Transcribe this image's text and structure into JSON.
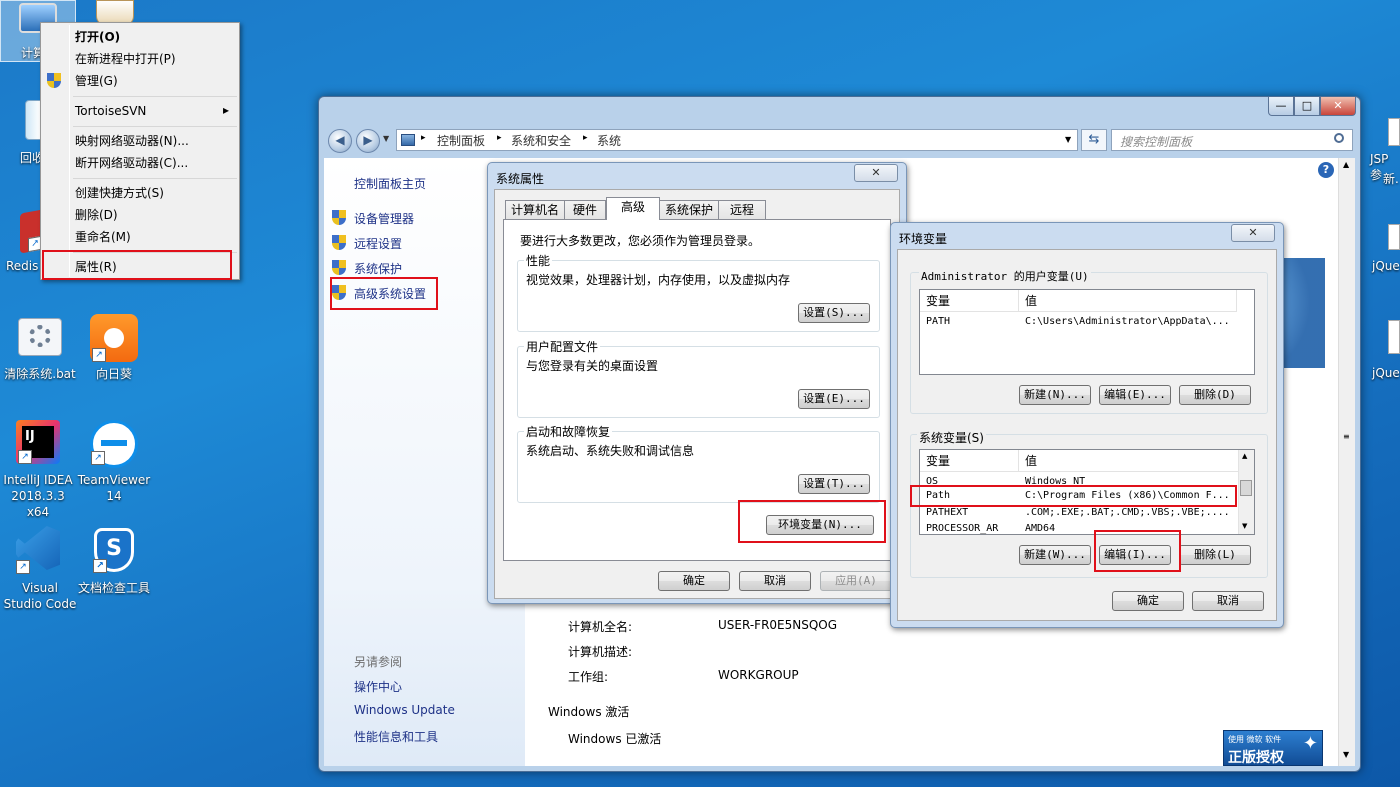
{
  "desktop": {
    "icons": [
      {
        "label": "计算"
      },
      {
        "label": "回收"
      },
      {
        "label": "Redis"
      },
      {
        "label": "清除系统.bat"
      },
      {
        "label": "向日葵"
      },
      {
        "label": "IntelliJ IDEA 2018.3.3 x64"
      },
      {
        "label": "TeamViewer 14"
      },
      {
        "label": "Visual Studio Code"
      },
      {
        "label": "文档检查工具"
      }
    ],
    "right_labels": [
      "JSP参",
      "新.",
      "jQue",
      "jQue"
    ]
  },
  "context_menu": {
    "items": [
      {
        "label": "打开(O)"
      },
      {
        "label": "在新进程中打开(P)"
      },
      {
        "label": "管理(G)"
      },
      {
        "label": "TortoiseSVN",
        "submenu": "▸"
      },
      {
        "label": "映射网络驱动器(N)..."
      },
      {
        "label": "断开网络驱动器(C)..."
      },
      {
        "label": "创建快捷方式(S)"
      },
      {
        "label": "删除(D)"
      },
      {
        "label": "重命名(M)"
      },
      {
        "label": "属性(R)"
      }
    ]
  },
  "window": {
    "controls": {
      "minimize": "—",
      "maximize": "□",
      "close": "✕"
    },
    "breadcrumb": [
      "控制面板",
      "系统和安全",
      "系统"
    ],
    "search_placeholder": "搜索控制面板",
    "left_nav": {
      "home": "控制面板主页",
      "items": [
        "设备管理器",
        "远程设置",
        "系统保护",
        "高级系统设置"
      ],
      "see_also_title": "另请参阅",
      "see_also": [
        "操作中心",
        "Windows Update",
        "性能信息和工具"
      ]
    },
    "computer_info": [
      {
        "label": "计算机全名:",
        "value": "USER-FR0E5NSQOG"
      },
      {
        "label": "计算机描述:",
        "value": ""
      },
      {
        "label": "工作组:",
        "value": "WORKGROUP"
      }
    ],
    "activation_title": "Windows 激活",
    "activation_status": "Windows 已激活",
    "badge": {
      "small": "使用 微软 软件",
      "big": "正版授权"
    }
  },
  "sys_props": {
    "title": "系统属性",
    "tabs": [
      "计算机名",
      "硬件",
      "高级",
      "系统保护",
      "远程"
    ],
    "admin_note": "要进行大多数更改，您必须作为管理员登录。",
    "groups": [
      {
        "title": "性能",
        "desc": "视觉效果，处理器计划，内存使用，以及虚拟内存",
        "button": "设置(S)..."
      },
      {
        "title": "用户配置文件",
        "desc": "与您登录有关的桌面设置",
        "button": "设置(E)..."
      },
      {
        "title": "启动和故障恢复",
        "desc": "系统启动、系统失败和调试信息",
        "button": "设置(T)..."
      }
    ],
    "env_button": "环境变量(N)...",
    "ok": "确定",
    "cancel": "取消",
    "apply": "应用(A)"
  },
  "env_vars": {
    "title": "环境变量",
    "user_section": "Administrator 的用户变量(U)",
    "columns": [
      "变量",
      "值"
    ],
    "user_rows": [
      {
        "name": "PATH",
        "value": "C:\\Users\\Administrator\\AppData\\..."
      }
    ],
    "user_buttons": [
      "新建(N)...",
      "编辑(E)...",
      "删除(D)"
    ],
    "system_section": "系统变量(S)",
    "system_rows": [
      {
        "name": "OS",
        "value": "Windows_NT"
      },
      {
        "name": "Path",
        "value": "C:\\Program Files (x86)\\Common F..."
      },
      {
        "name": "PATHEXT",
        "value": ".COM;.EXE;.BAT;.CMD;.VBS;.VBE;...."
      },
      {
        "name": "PROCESSOR_AR",
        "value": "AMD64"
      }
    ],
    "system_buttons": [
      "新建(W)...",
      "编辑(I)...",
      "删除(L)"
    ],
    "ok": "确定",
    "cancel": "取消"
  }
}
